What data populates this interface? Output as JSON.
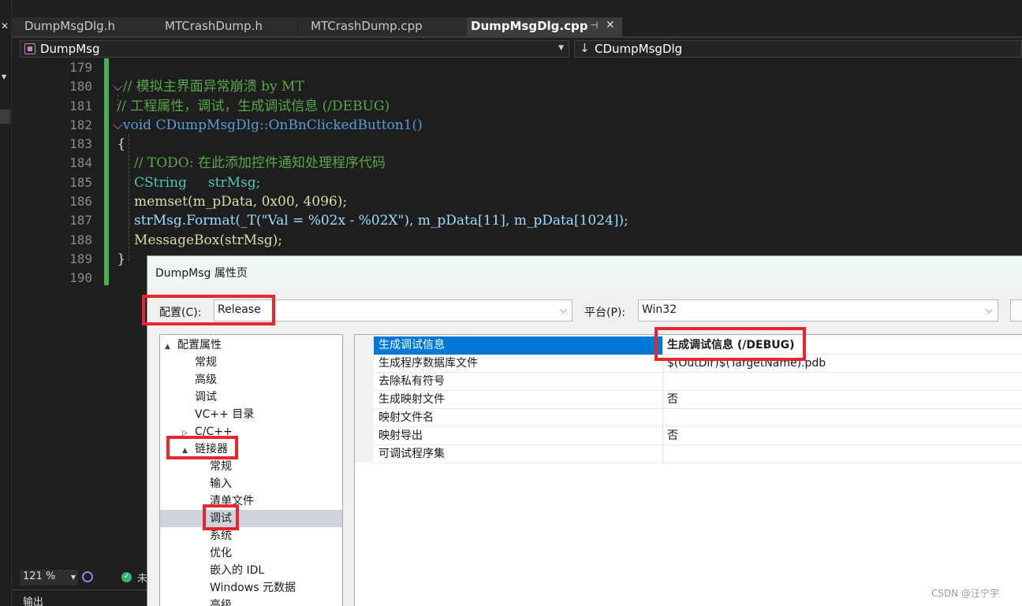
{
  "tabs": [
    {
      "label": "DumpMsgDlg.h",
      "active": false
    },
    {
      "label": "MTCrashDump.h",
      "active": false
    },
    {
      "label": "MTCrashDump.cpp",
      "active": false
    },
    {
      "label": "DumpMsgDlg.cpp",
      "active": true
    }
  ],
  "tab_icons": {
    "pin": "pin-icon",
    "close": "close-icon"
  },
  "nav": {
    "project": "DumpMsg",
    "scope": "CDumpMsgDlg"
  },
  "editor": {
    "line_numbers": [
      "179",
      "180",
      "181",
      "182",
      "183",
      "184",
      "185",
      "186",
      "187",
      "188",
      "189",
      "190"
    ],
    "lines": [
      "",
      "// 模拟主界面异常崩溃 by MT",
      "// 工程属性，调试，生成调试信息 (/DEBUG)",
      "void CDumpMsgDlg::OnBnClickedButton1()",
      "{",
      "    // TODO: 在此添加控件通知处理程序代码",
      "    CString     strMsg;",
      "    memset(m_pData, 0x00, 4096);",
      "    strMsg.Format(_T(\"Val = %02x - %02X\"), m_pData[11], m_pData[1024]);",
      "    MessageBox(strMsg);",
      "}",
      ""
    ]
  },
  "status": {
    "zoom": "121 %",
    "issues_text": "未"
  },
  "bottom_panel": {
    "title": "输出"
  },
  "dialog": {
    "title": "DumpMsg 属性页",
    "config_label": "配置(C):",
    "config_value": "Release",
    "platform_label": "平台(P):",
    "platform_value": "Win32",
    "tree": [
      {
        "label": "配置属性",
        "level": 0,
        "expander": "▲"
      },
      {
        "label": "常规",
        "level": 1
      },
      {
        "label": "高级",
        "level": 1
      },
      {
        "label": "调试",
        "level": 1
      },
      {
        "label": "VC++ 目录",
        "level": 1
      },
      {
        "label": "C/C++",
        "level": 1,
        "expander": "▷"
      },
      {
        "label": "链接器",
        "level": 1,
        "expander": "▲"
      },
      {
        "label": "常规",
        "level": 2
      },
      {
        "label": "输入",
        "level": 2
      },
      {
        "label": "清单文件",
        "level": 2
      },
      {
        "label": "调试",
        "level": 2,
        "selected": true
      },
      {
        "label": "系统",
        "level": 2
      },
      {
        "label": "优化",
        "level": 2
      },
      {
        "label": "嵌入的 IDL",
        "level": 2
      },
      {
        "label": "Windows 元数据",
        "level": 2
      },
      {
        "label": "高级",
        "level": 2
      }
    ],
    "properties": [
      {
        "name": "生成调试信息",
        "value": "生成调试信息 (/DEBUG)",
        "selected": true
      },
      {
        "name": "生成程序数据库文件",
        "value": "$(OutDir)$(TargetName).pdb"
      },
      {
        "name": "去除私有符号",
        "value": ""
      },
      {
        "name": "生成映射文件",
        "value": "否"
      },
      {
        "name": "映射文件名",
        "value": ""
      },
      {
        "name": "映射导出",
        "value": "否"
      },
      {
        "name": "可调试程序集",
        "value": ""
      }
    ]
  },
  "highlight_color": "#e8262d",
  "watermark": "CSDN @汪宁宇"
}
